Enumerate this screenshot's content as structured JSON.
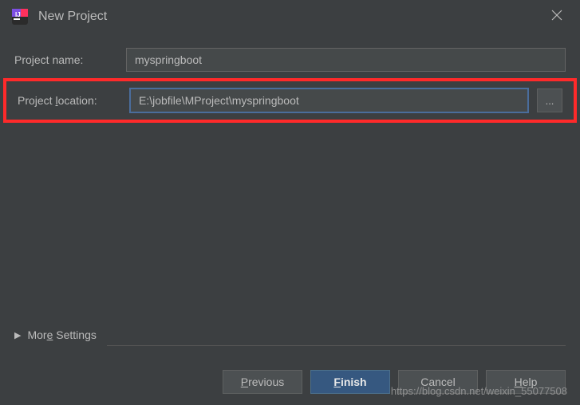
{
  "window": {
    "title": "New Project"
  },
  "form": {
    "name_label": "Project name:",
    "name_value": "myspringboot",
    "location_label": "Project location:",
    "location_value": "E:\\jobfile\\MProject\\myspringboot",
    "browse_label": "..."
  },
  "more": {
    "label": "More Settings"
  },
  "buttons": {
    "previous": "Previous",
    "finish": "Finish",
    "cancel": "Cancel",
    "help": "Help"
  },
  "watermark": "https://blog.csdn.net/weixin_55077508"
}
